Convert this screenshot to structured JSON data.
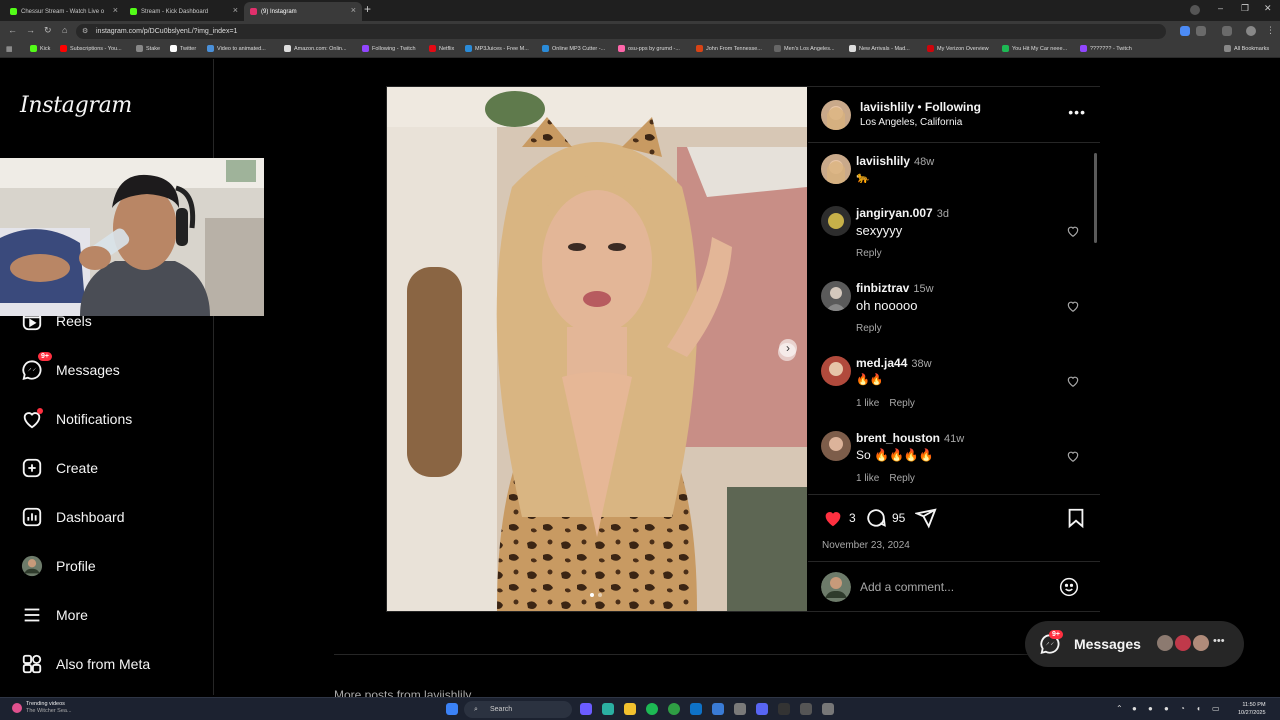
{
  "browser": {
    "tabs": [
      {
        "label": "Chessur Stream - Watch Live o",
        "color": "#53fc18"
      },
      {
        "label": "Stream - Kick Dashboard",
        "color": "#53fc18"
      },
      {
        "label": "(9) Instagram",
        "color": "#e1306c"
      }
    ],
    "url": "instagram.com/p/DCu0bslyenL/?img_index=1",
    "bookmarks": [
      {
        "label": "Kick",
        "color": "#53fc18"
      },
      {
        "label": "Subscriptions - You...",
        "color": "#ff0000"
      },
      {
        "label": "Stake",
        "color": "#1a2c38"
      },
      {
        "label": "Twitter",
        "color": "#000000"
      },
      {
        "label": "Video to animated...",
        "color": "#4a90d9"
      },
      {
        "label": "Amazon.com: Onlin...",
        "color": "#ffffff"
      },
      {
        "label": "Following - Twitch",
        "color": "#9146ff"
      },
      {
        "label": "Netflix",
        "color": "#e50914"
      },
      {
        "label": "MP3Juices - Free M...",
        "color": "#2a8bd8"
      },
      {
        "label": "Online MP3 Cutter -...",
        "color": "#2a8bd8"
      },
      {
        "label": "osu-pps by grumd -...",
        "color": "#ff66aa"
      },
      {
        "label": "John From Tennesse...",
        "color": "#d84315"
      },
      {
        "label": "Men's Los Angeles...",
        "color": "#444444"
      },
      {
        "label": "New Arrivals - Mad...",
        "color": "#ffffff"
      },
      {
        "label": "My Verizon Overview",
        "color": "#cd040b"
      },
      {
        "label": "You Hit My Car neee...",
        "color": "#1db954"
      },
      {
        "label": "??????? - Twitch",
        "color": "#9146ff"
      }
    ],
    "all_bookmarks": "All Bookmarks"
  },
  "instagram": {
    "logo": "Instagram",
    "nav": [
      {
        "label": "Reels",
        "icon": "reels-icon"
      },
      {
        "label": "Messages",
        "icon": "messages-icon",
        "badge": "9+"
      },
      {
        "label": "Notifications",
        "icon": "heart-icon"
      },
      {
        "label": "Create",
        "icon": "create-icon"
      },
      {
        "label": "Dashboard",
        "icon": "dashboard-icon"
      },
      {
        "label": "Profile",
        "icon": "avatar"
      },
      {
        "label": "More",
        "icon": "menu-icon"
      },
      {
        "label": "Also from Meta",
        "icon": "meta-icon"
      }
    ],
    "post": {
      "username": "laviishlily",
      "following": "Following",
      "location": "Los Angeles, California",
      "caption_time": "48w",
      "caption_emoji": "🐆",
      "comments": [
        {
          "user": "jangiryan.007",
          "time": "3d",
          "text": "sexyyyy",
          "meta": [
            "Reply"
          ]
        },
        {
          "user": "finbiztrav",
          "time": "15w",
          "text": "oh nooooo",
          "meta": [
            "Reply"
          ]
        },
        {
          "user": "med.ja44",
          "time": "38w",
          "text": "🔥🔥",
          "meta": [
            "1 like",
            "Reply"
          ]
        },
        {
          "user": "brent_houston",
          "time": "41w",
          "text": "So 🔥🔥🔥🔥",
          "meta": [
            "1 like",
            "Reply"
          ]
        }
      ],
      "likes": "3",
      "comment_count": "95",
      "date": "November 23, 2024",
      "comment_placeholder": "Add a comment..."
    },
    "more_posts": "More posts from laviishlily",
    "messages_pill": {
      "label": "Messages",
      "badge": "9+"
    }
  },
  "taskbar": {
    "weather_title": "Trending videos",
    "weather_sub": "The Witcher Sea...",
    "search": "Search",
    "time": "11:50 PM",
    "date": "10/27/2025"
  }
}
